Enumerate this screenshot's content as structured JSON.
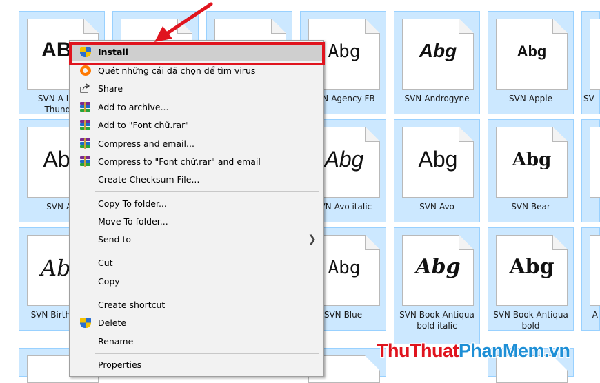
{
  "context_menu": {
    "install": "Install",
    "scan_virus": "Quét những cái đã chọn để tìm virus",
    "share": "Share",
    "add_archive": "Add to archive...",
    "add_rar": "Add to \"Font chữ.rar\"",
    "compress_email": "Compress and email...",
    "compress_rar_email": "Compress to \"Font chữ.rar\" and email",
    "checksum": "Create Checksum File...",
    "copy_to": "Copy To folder...",
    "move_to": "Move To folder...",
    "send_to": "Send to",
    "cut": "Cut",
    "copy": "Copy",
    "create_shortcut": "Create shortcut",
    "delete": "Delete",
    "rename": "Rename",
    "properties": "Properties"
  },
  "files": {
    "r1": [
      {
        "sample": "ABg",
        "name": "SVN-A Love Thunder"
      },
      {
        "sample": "",
        "name": ""
      },
      {
        "sample": "",
        "name": ""
      },
      {
        "sample": "Abg",
        "name": "SVN-Agency FB"
      },
      {
        "sample": "Abg",
        "name": "SVN-Androgyne"
      },
      {
        "sample": "Abg",
        "name": "SVN-Apple"
      },
      {
        "sample": "",
        "name": "SV"
      }
    ],
    "r2": [
      {
        "sample": "Abg",
        "name": "SVN-Ap"
      },
      {
        "sample": "Abg",
        "name": "SVN-Avo italic"
      },
      {
        "sample": "Abg",
        "name": "SVN-Avo"
      },
      {
        "sample": "Abg",
        "name": "SVN-Bear"
      }
    ],
    "r3": [
      {
        "sample": "Abg",
        "name": "SVN-Birth Here"
      },
      {
        "sample": "Abg",
        "name": "SVN-Blue"
      },
      {
        "sample": "Abg",
        "name": "SVN-Book Antiqua bold italic"
      },
      {
        "sample": "Abg",
        "name": "SVN-Book Antiqua bold"
      },
      {
        "sample": "",
        "name": "A"
      }
    ]
  },
  "watermark": {
    "part1": "ThuThuat",
    "part2": "PhanMem.vn"
  },
  "colors": {
    "selection": "#cce8ff",
    "highlight_box": "#e0141e",
    "watermark_blue": "#1e8fd6"
  }
}
